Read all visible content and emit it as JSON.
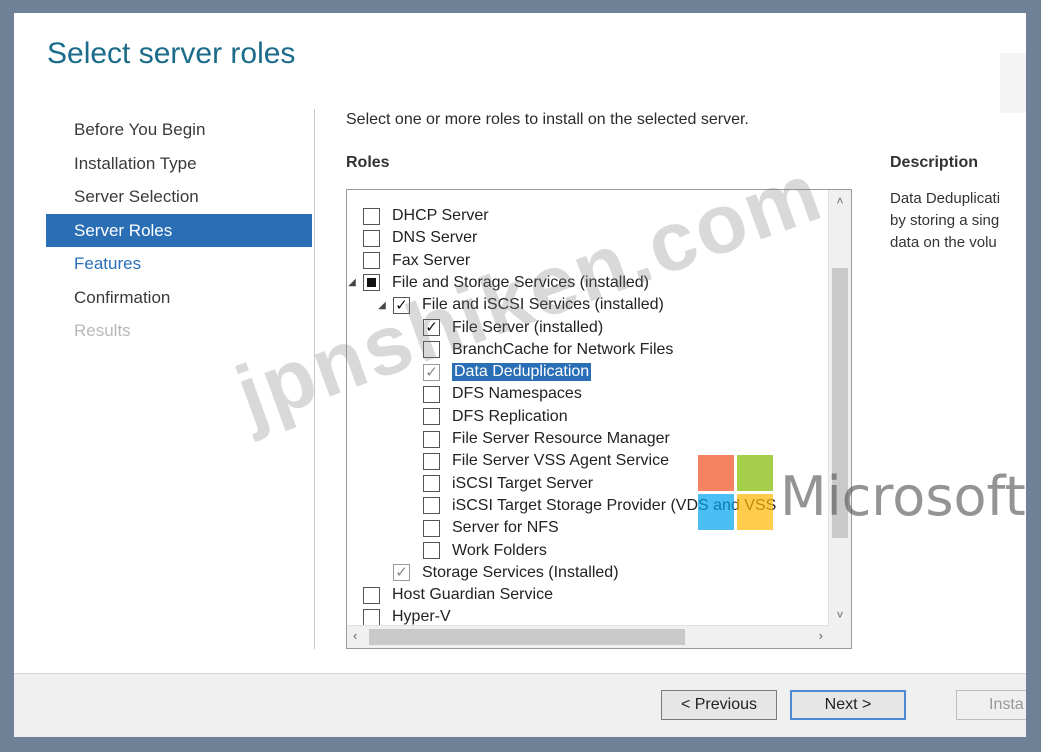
{
  "page_title": "Select server roles",
  "nav": [
    {
      "label": "Before You Begin",
      "state": "normal"
    },
    {
      "label": "Installation Type",
      "state": "normal"
    },
    {
      "label": "Server Selection",
      "state": "normal"
    },
    {
      "label": "Server Roles",
      "state": "selected"
    },
    {
      "label": "Features",
      "state": "link"
    },
    {
      "label": "Confirmation",
      "state": "normal"
    },
    {
      "label": "Results",
      "state": "disabled"
    }
  ],
  "intro": "Select one or more roles to install on the selected server.",
  "roles_label": "Roles",
  "description": {
    "label": "Description",
    "lines": [
      "Data Deduplicati",
      "by storing a sing",
      "data on the volu"
    ]
  },
  "roles": [
    {
      "label": "DHCP Server",
      "level": 0,
      "checkbox": "unchecked",
      "expander": ""
    },
    {
      "label": "DNS Server",
      "level": 0,
      "checkbox": "unchecked",
      "expander": ""
    },
    {
      "label": "Fax Server",
      "level": 0,
      "checkbox": "unchecked",
      "expander": ""
    },
    {
      "label": "File and Storage Services  (installed)",
      "level": 0,
      "checkbox": "partial",
      "expander": "expanded"
    },
    {
      "label": "File and iSCSI Services (installed)",
      "level": 1,
      "checkbox": "checked",
      "expander": "expanded"
    },
    {
      "label": "File Server  (installed)",
      "level": 2,
      "checkbox": "checked",
      "expander": ""
    },
    {
      "label": "BranchCache for Network Files",
      "level": 2,
      "checkbox": "unchecked",
      "expander": ""
    },
    {
      "label": "Data Deduplication",
      "level": 2,
      "checkbox": "checked-grey",
      "expander": "",
      "selected": true
    },
    {
      "label": "DFS Namespaces",
      "level": 2,
      "checkbox": "unchecked",
      "expander": ""
    },
    {
      "label": "DFS Replication",
      "level": 2,
      "checkbox": "unchecked",
      "expander": ""
    },
    {
      "label": "File Server Resource Manager",
      "level": 2,
      "checkbox": "unchecked",
      "expander": ""
    },
    {
      "label": "File Server VSS Agent Service",
      "level": 2,
      "checkbox": "unchecked",
      "expander": ""
    },
    {
      "label": "iSCSI Target Server",
      "level": 2,
      "checkbox": "unchecked",
      "expander": ""
    },
    {
      "label": "iSCSI Target Storage Provider (VDS and VSS",
      "level": 2,
      "checkbox": "unchecked",
      "expander": ""
    },
    {
      "label": "Server for NFS",
      "level": 2,
      "checkbox": "unchecked",
      "expander": ""
    },
    {
      "label": "Work Folders",
      "level": 2,
      "checkbox": "unchecked",
      "expander": ""
    },
    {
      "label": "Storage Services (Installed)",
      "level": 1,
      "checkbox": "checked-grey",
      "expander": ""
    },
    {
      "label": "Host Guardian Service",
      "level": 0,
      "checkbox": "unchecked",
      "expander": ""
    },
    {
      "label": "Hyper-V",
      "level": 0,
      "checkbox": "unchecked",
      "expander": ""
    }
  ],
  "buttons": {
    "previous": "< Previous",
    "next": "Next >",
    "install": "Insta"
  },
  "watermark": "jpnshiken.com",
  "logo_text": "Microsoft"
}
